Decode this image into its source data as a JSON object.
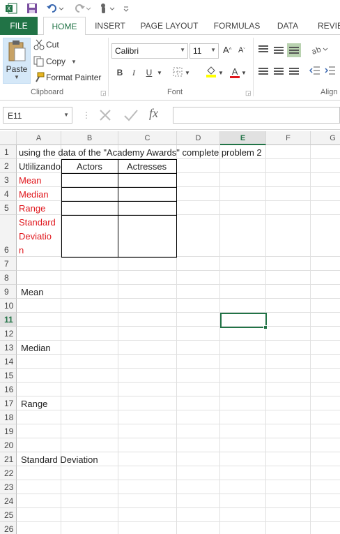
{
  "qat": {
    "icons": [
      "excel-logo-icon",
      "save-icon",
      "undo-icon",
      "redo-icon",
      "touch-mode-icon",
      "customize-qat-icon"
    ]
  },
  "tabs": [
    {
      "label": "FILE"
    },
    {
      "label": "HOME"
    },
    {
      "label": "INSERT"
    },
    {
      "label": "PAGE LAYOUT"
    },
    {
      "label": "FORMULAS"
    },
    {
      "label": "DATA"
    },
    {
      "label": "REVIEW"
    }
  ],
  "ribbon": {
    "clipboard": {
      "paste": "Paste",
      "cut": "Cut",
      "copy": "Copy",
      "format_painter": "Format Painter",
      "label": "Clipboard"
    },
    "font": {
      "font_name": "Calibri",
      "font_size": "11",
      "bold": "B",
      "italic": "I",
      "underline": "U",
      "grow": "A",
      "shrink": "A",
      "font_color_letter": "A",
      "label": "Font"
    },
    "alignment": {
      "label": "Align"
    }
  },
  "formula_bar": {
    "name_box": "E11",
    "fx": "fx",
    "value": ""
  },
  "grid": {
    "columns": [
      "A",
      "B",
      "C",
      "D",
      "E",
      "F",
      "G"
    ],
    "active_column": "E",
    "rows": [
      "1",
      "2",
      "3",
      "4",
      "5",
      "6",
      "7",
      "8",
      "9",
      "10",
      "11",
      "12",
      "13",
      "14",
      "15",
      "16",
      "17",
      "18",
      "19",
      "20",
      "21",
      "22",
      "23",
      "24",
      "25",
      "26"
    ],
    "active_row": "11",
    "active_cell": "E11",
    "cells": {
      "A1": "using  the  data of  the  \"Academy Awards\" complete problem 2",
      "A2": "Utlilizando",
      "B2": "Actors",
      "C2": "Actresses",
      "A3": "Mean",
      "A4": "Median",
      "A5": "Range",
      "A6_line1": "Standard",
      "A6_line2": "Deviatio",
      "A6_line3": "n",
      "A9": "Mean",
      "A13": "Median",
      "A17": "Range",
      "A21": "Standard Deviation"
    },
    "colors": {
      "red_text": "#e0161c",
      "accent": "#217346"
    }
  }
}
